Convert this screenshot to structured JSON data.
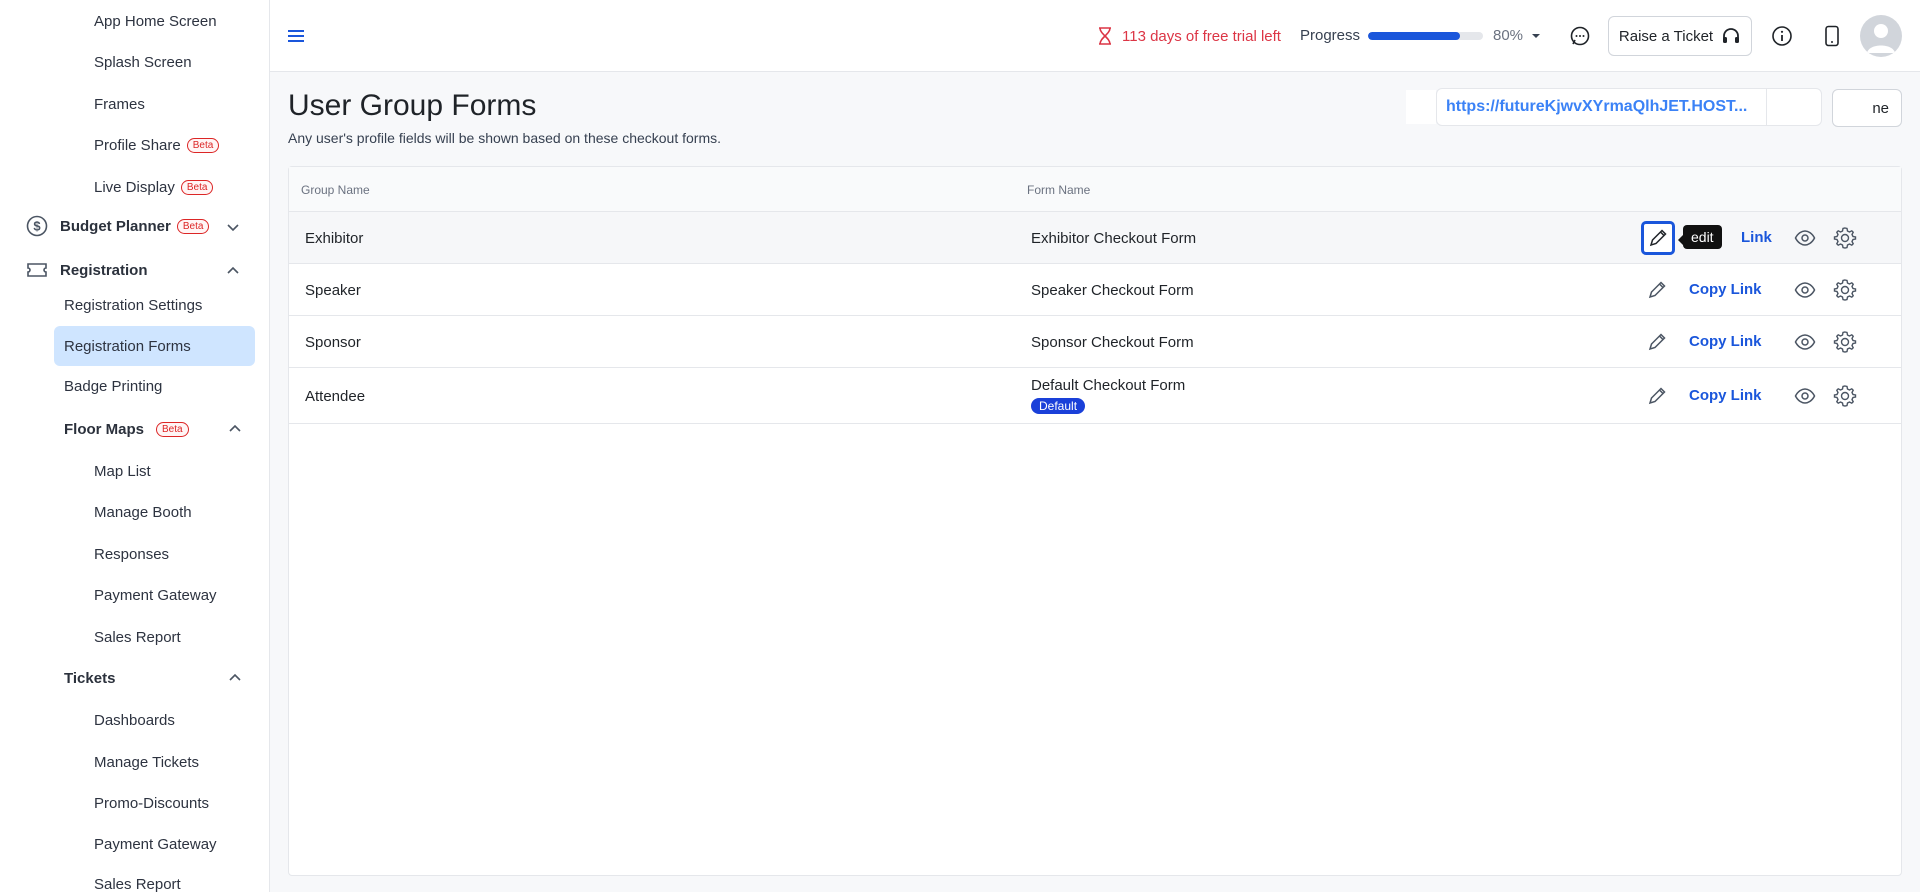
{
  "sidebar": {
    "items": [
      {
        "label": "App Home Screen"
      },
      {
        "label": "Splash Screen"
      },
      {
        "label": "Frames"
      },
      {
        "label": "Profile Share",
        "badge": "Beta"
      },
      {
        "label": "Live Display",
        "badge": "Beta"
      }
    ],
    "budget_planner": {
      "label": "Budget Planner",
      "badge": "Beta",
      "icon": "dollar-circle-icon"
    },
    "registration": {
      "label": "Registration",
      "icon": "ticket-icon",
      "items": [
        {
          "label": "Registration Settings"
        },
        {
          "label": "Registration Forms",
          "active": true
        },
        {
          "label": "Badge Printing"
        }
      ]
    },
    "floor_maps": {
      "label": "Floor Maps",
      "badge": "Beta",
      "items": [
        {
          "label": "Map List"
        },
        {
          "label": "Manage Booth"
        },
        {
          "label": "Responses"
        },
        {
          "label": "Payment Gateway"
        },
        {
          "label": "Sales Report"
        }
      ]
    },
    "tickets": {
      "label": "Tickets",
      "items": [
        {
          "label": "Dashboards"
        },
        {
          "label": "Manage Tickets"
        },
        {
          "label": "Promo-Discounts"
        },
        {
          "label": "Payment Gateway"
        },
        {
          "label": "Sales Report"
        }
      ]
    }
  },
  "header": {
    "trial_text": "113 days of free trial left",
    "progress_label": "Progress",
    "progress_value": "80%",
    "progress_fraction": 0.8,
    "raise_ticket_label": "Raise a Ticket",
    "accent_color": "#1a56db",
    "trial_color": "#dc3545"
  },
  "main": {
    "title": "User Group Forms",
    "subtitle": "Any user's profile fields will be shown based on these checkout forms.",
    "url": "https://futureKjwvXYrmaQlhJET.HOST...",
    "side_button_label": "ne",
    "table": {
      "columns": [
        "Group Name",
        "Form Name"
      ],
      "rows": [
        {
          "group": "Exhibitor",
          "form": "Exhibitor Checkout Form",
          "link_label": "Link"
        },
        {
          "group": "Speaker",
          "form": "Speaker Checkout Form",
          "link_label": "Copy Link"
        },
        {
          "group": "Sponsor",
          "form": "Sponsor Checkout Form",
          "link_label": "Copy Link"
        },
        {
          "group": "Attendee",
          "form": "Default Checkout Form",
          "badge": "Default",
          "link_label": "Copy Link"
        }
      ]
    },
    "tooltip": "edit"
  }
}
